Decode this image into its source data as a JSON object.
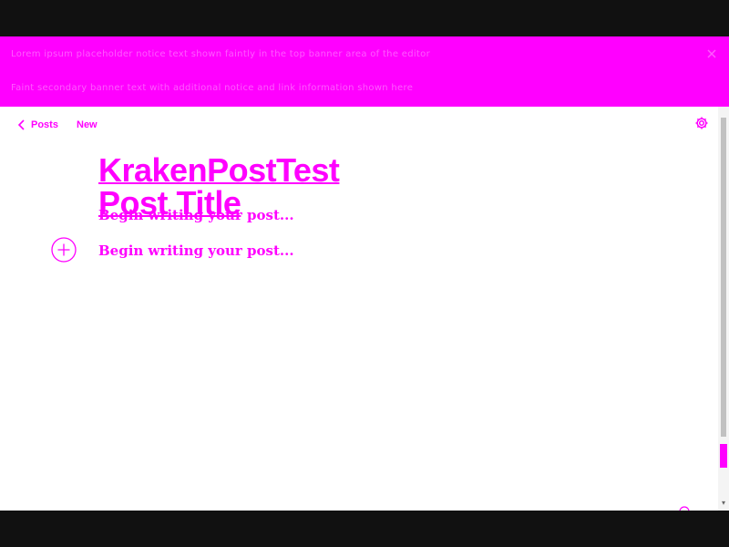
{
  "colors": {
    "accent": "#ff00ff",
    "chrome": "#111111",
    "background": "#ffffff"
  },
  "banner": {
    "line1": "Lorem ipsum placeholder notice text shown faintly in the top banner area of the editor",
    "line2": "Faint secondary banner text with additional notice and link information shown here"
  },
  "nav": {
    "back_label": "Posts",
    "new_label": "New"
  },
  "post": {
    "title_line1": "KrakenPostTest",
    "title_line2": "Post Title",
    "body_placeholder": "Begin writing your post..."
  },
  "icons": {
    "back": "chevron-left-icon",
    "settings": "gear-icon",
    "add": "plus-circle-icon",
    "close": "close-icon",
    "help": "help-icon"
  }
}
